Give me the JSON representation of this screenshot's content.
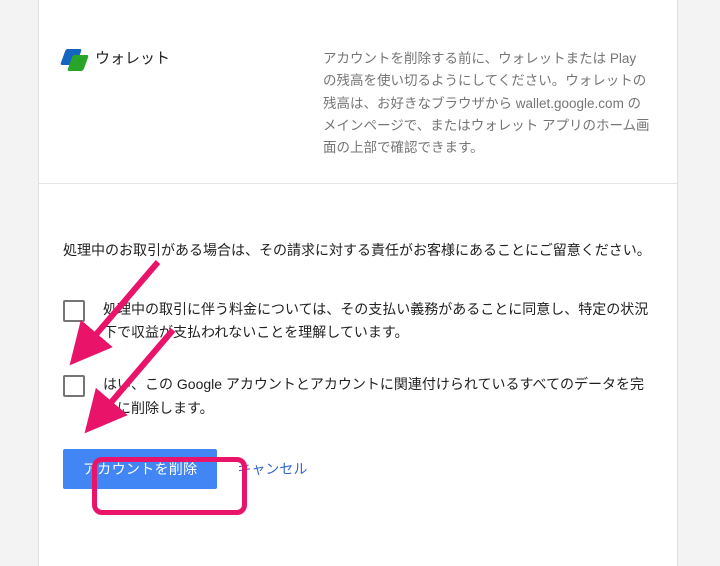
{
  "service": {
    "icon_name": "wallet-icon",
    "title": "ウォレット",
    "description": "アカウントを削除する前に、ウォレットまたは Play の残高を使い切るようにしてください。ウォレットの残高は、お好きなブラウザから wallet.google.com のメインページで、またはウォレット アプリのホーム画面の上部で確認できます。"
  },
  "note": "処理中のお取引がある場合は、その請求に対する責任がお客様にあることにご留意ください。",
  "confirmations": [
    {
      "checked": false,
      "label": "処理中の取引に伴う料金については、その支払い義務があることに同意し、特定の状況下で収益が支払われないことを理解しています。"
    },
    {
      "checked": false,
      "label": "はい、この Google アカウントとアカウントに関連付けられているすべてのデータを完全に削除します。"
    }
  ],
  "buttons": {
    "primary": "アカウントを削除",
    "cancel": "キャンセル"
  },
  "colors": {
    "primary_button": "#4285f4",
    "link": "#3367d6",
    "annotation": "#e9146a"
  }
}
